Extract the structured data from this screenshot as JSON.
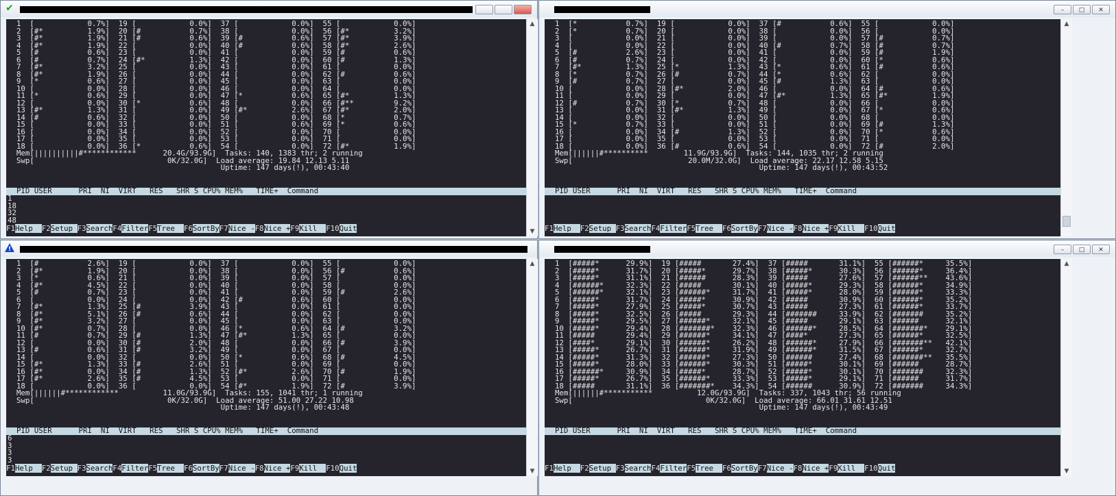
{
  "panes": [
    {
      "title_icon": "check-icon",
      "lines": [
        "  1  [            0.7%]  19 [            0.0%]  37 [            0.0%]  55 [            0.0%]",
        "  2  [#*          1.9%]  20 [#           0.7%]  38 [            0.0%]  56 [#*          3.2%]",
        "  3  [#*          1.9%]  21 [#           0.6%]  39 [#           0.6%]  57 [#*          3.9%]",
        "  4  [#*          1.9%]  22 [            0.0%]  40 [#           0.6%]  58 [#*          2.6%]",
        "  5  [#           0.6%]  23 [            0.0%]  41 [            0.0%]  59 [#           0.6%]",
        "  6  [#           0.7%]  24 [#*          1.3%]  42 [            0.0%]  60 [#           1.3%]",
        "  7  [#*          3.2%]  25 [            0.0%]  43 [            0.0%]  61 [            0.0%]",
        "  8  [#*          1.9%]  26 [            0.0%]  44 [            0.0%]  62 [#           0.6%]",
        "  9  [*           0.6%]  27 [            0.0%]  45 [            0.0%]  63 [            0.0%]",
        "  10 [            0.0%]  28 [            0.0%]  46 [            0.0%]  64 [            0.0%]",
        "  11 [*           0.6%]  29 [            0.0%]  47 [*           0.6%]  65 [#*          1.3%]",
        "  12 [            0.0%]  30 [*           0.6%]  48 [            0.0%]  66 [#**         9.2%]",
        "  13 [#*          1.3%]  31 [            0.0%]  49 [#*          2.6%]  67 [#*          2.0%]",
        "  14 [#           0.6%]  32 [            0.0%]  50 [            0.0%]  68 [*           0.7%]",
        "  15 [            0.0%]  33 [            0.0%]  51 [            0.6%]  69 [*           0.6%]",
        "  16 [            0.0%]  34 [            0.0%]  52 [            0.0%]  70 [            0.0%]",
        "  17 [            0.0%]  35 [            0.0%]  53 [            0.0%]  71 [            0.0%]",
        "  18 [            0.0%]  36 [*           0.6%]  54 [            0.0%]  72 [#*          1.9%]",
        "  Mem[||||||||||#************      20.4G/93.9G]  Tasks: 140, 1383 thr; 2 running",
        "  Swp[                              0K/32.0G]  Load average: 19.84 12.13 5.11",
        "                                                Uptime: 147 days(!), 00:43:40"
      ],
      "process_lines": [
        "1",
        "18",
        "32",
        "48"
      ]
    },
    {
      "title_icon": "none",
      "lines": [
        "  1  [*           0.7%]  19 [            0.0%]  37 [#           0.6%]  55 [            0.0%]",
        "  2  [*           0.7%]  20 [            0.0%]  38 [            0.0%]  56 [            0.0%]",
        "  3  [            0.0%]  21 [            0.0%]  39 [            0.0%]  57 [#           0.7%]",
        "  4  [            0.0%]  22 [            0.0%]  40 [#           0.7%]  58 [#           0.7%]",
        "  5  [#           2.6%]  23 [            0.0%]  41 [            0.0%]  59 [#           1.9%]",
        "  6  [#           0.7%]  24 [            0.0%]  42 [            0.0%]  60 [*           0.6%]",
        "  7  [#*          1.3%]  25 [*           1.3%]  43 [*           0.6%]  61 [#           0.6%]",
        "  8  [*           0.7%]  26 [#           0.7%]  44 [*           0.6%]  62 [            0.0%]",
        "  9  [#           0.7%]  27 [            0.0%]  45 [#           1.3%]  63 [            0.0%]",
        "  10 [            0.0%]  28 [#*          2.0%]  46 [            0.0%]  64 [#           0.6%]",
        "  11 [            0.0%]  29 [            0.0%]  47 [#*          1.3%]  65 [#*          1.9%]",
        "  12 [#           0.7%]  30 [*           0.7%]  48 [            0.0%]  66 [            0.0%]",
        "  13 [            0.0%]  31 [#*          1.3%]  49 [            0.0%]  67 [*           0.6%]",
        "  14 [            0.0%]  32 [            0.0%]  50 [            0.0%]  68 [            0.0%]",
        "  15 [*           0.7%]  33 [            0.0%]  51 [            0.0%]  69 [#           1.3%]",
        "  16 [            0.0%]  34 [#           1.3%]  52 [            0.0%]  70 [*           0.6%]",
        "  17 [            0.0%]  35 [            0.0%]  53 [            0.0%]  71 [            0.0%]",
        "  18 [            0.0%]  36 [#           0.6%]  54 [            0.0%]  72 [#           2.0%]",
        "  Mem[||||||#**********        11.9G/93.9G]  Tasks: 144, 1035 thr; 2 running",
        "  Swp[                          20.0M/32.0G]  Load average: 22.17 12.58 5.15",
        "                                                Uptime: 147 days(!), 00:43:52"
      ],
      "process_lines": []
    },
    {
      "title_icon": "warning-icon",
      "lines": [
        "  1  [#           2.6%]  19 [            0.0%]  37 [            0.0%]  55 [            0.0%]",
        "  2  [#*          1.9%]  20 [            0.0%]  38 [            0.0%]  56 [#           0.6%]",
        "  3  [*           0.6%]  21 [            0.0%]  39 [            0.0%]  57 [            0.0%]",
        "  4  [#*          4.5%]  22 [            0.0%]  40 [            0.0%]  58 [            0.0%]",
        "  5  [#           0.7%]  23 [            0.0%]  41 [            0.0%]  59 [#           2.6%]",
        "  6  [            0.0%]  24 [            0.0%]  42 [#           0.6%]  60 [            0.0%]",
        "  7  [#*          1.3%]  25 [#           3.9%]  43 [            0.0%]  61 [            0.0%]",
        "  8  [#*          5.1%]  26 [#           0.6%]  44 [            0.0%]  62 [            0.0%]",
        "  9  [#*          3.2%]  27 [            0.0%]  45 [            0.0%]  63 [            0.0%]",
        "  10 [#*          0.7%]  28 [            0.0%]  46 [*           0.6%]  64 [#           3.2%]",
        "  11 [#           0.7%]  29 [#           1.3%]  47 [#*          1.3%]  65 [            0.0%]",
        "  12 [            0.0%]  30 [#           2.0%]  48 [            0.0%]  66 [#           3.9%]",
        "  13 [#           0.6%]  31 [#           3.2%]  49 [            0.0%]  67 [            0.0%]",
        "  14 [            0.0%]  32 [            0.0%]  50 [*           0.6%]  68 [#           4.5%]",
        "  15 [#*          1.3%]  33 [#           2.6%]  51 [            0.0%]  69 [            0.0%]",
        "  16 [#*          0.0%]  34 [#           1.3%]  52 [#*          2.6%]  70 [#           1.9%]",
        "  17 [#*          2.6%]  35 [#           4.5%]  53 [            0.0%]  71 [            0.0%]",
        "  18 [            0.0%]  36 [            0.0%]  54 [#*          1.9%]  72 [#           3.9%]",
        "  Mem[||||||#************          11.0G/93.9G]  Tasks: 155, 1041 thr; 1 running",
        "  Swp[                              0K/32.0G]  Load average: 51.00 27.22 10.98",
        "                                                Uptime: 147 days(!), 00:43:48"
      ],
      "process_lines": [
        "6",
        "3",
        "3",
        "3"
      ]
    },
    {
      "title_icon": "none",
      "lines": [
        "  1  [#####*      29.9%]  19 [#####       27.4%]  37 [#####       31.1%]  55 [######*     35.5%]",
        "  2  [#####*      31.7%]  20 [#####*      29.7%]  38 [#####*      30.3%]  56 [######*     36.4%]",
        "  3  [#####*      31.1%]  21 [######      28.3%]  39 [#####       27.6%]  57 [######**    43.6%]",
        "  4  [######*     32.3%]  22 [#####       30.1%]  40 [#####*      29.3%]  58 [######*     34.9%]",
        "  5  [######*     32.1%]  23 [######*     31.7%]  41 [#####*      28.0%]  59 [######*     33.3%]",
        "  6  [#####*      31.7%]  24 [#####*      30.9%]  42 [#####       30.9%]  60 [######*     35.2%]",
        "  7  [#####*      27.9%]  25 [#####*      30.7%]  43 [#####       27.3%]  61 [######*     33.7%]",
        "  8  [#####*      32.5%]  26 [#####       29.3%]  44 [#######     33.9%]  62 [#######     35.2%]",
        "  9  [#####*      29.5%]  27 [######*     32.1%]  45 [#####       29.1%]  63 [######      32.1%]",
        "  10 [#####*      29.4%]  28 [#######*    32.3%]  46 [######*     28.5%]  64 [#######*    29.1%]",
        "  11 [#####       29.4%]  29 [######*     34.1%]  47 [####*       27.3%]  65 [######*     32.5%]",
        "  12 [####*       29.1%]  30 [######*     26.2%]  48 [######*     27.9%]  66 [#######**   42.1%]",
        "  13 [#####*      26.7%]  31 [######*     31.9%]  49 [######*     31.5%]  67 [######*     32.7%]",
        "  14 [#####*      31.3%]  32 [######*     27.3%]  50 [######      27.4%]  68 [#######**   35.5%]",
        "  15 [#####*      28.0%]  33 [######*     30.3%]  51 [#####*      30.1%]  69 [######      28.7%]",
        "  16 [######*     30.9%]  34 [#####*      28.7%]  52 [#####*      30.1%]  70 [#######     32.3%]",
        "  17 [#####*      26.7%]  35 [######*     33.3%]  53 [#####*      29.1%]  71 [######      31.7%]",
        "  18 [#####       31.1%]  36 [#######*    34.3%]  54 [######      30.9%]  72 [#######     34.3%]",
        "  Mem[||||||#***********          12.0G/93.9G]  Tasks: 337, 1043 thr; 56 running",
        "  Swp[                              0K/32.0G]  Load average: 66.01 31.61 12.51",
        "                                                Uptime: 147 days(!), 00:43:49"
      ],
      "process_lines": []
    }
  ],
  "table_header": "  PID USER      PRI  NI  VIRT   RES   SHR S CPU% MEM%   TIME+  Command",
  "function_keys": [
    {
      "key": "F1",
      "label": "Help  "
    },
    {
      "key": "F2",
      "label": "Setup "
    },
    {
      "key": "F3",
      "label": "Search"
    },
    {
      "key": "F4",
      "label": "Filter"
    },
    {
      "key": "F5",
      "label": "Tree  "
    },
    {
      "key": "F6",
      "label": "SortBy"
    },
    {
      "key": "F7",
      "label": "Nice -"
    },
    {
      "key": "F8",
      "label": "Nice +"
    },
    {
      "key": "F9",
      "label": "Kill  "
    },
    {
      "key": "F10",
      "label": "Quit"
    }
  ],
  "colors": {
    "terminal_bg": "#25242d",
    "header_bg": "#c5d9e3",
    "text": "#e6e6e6"
  }
}
